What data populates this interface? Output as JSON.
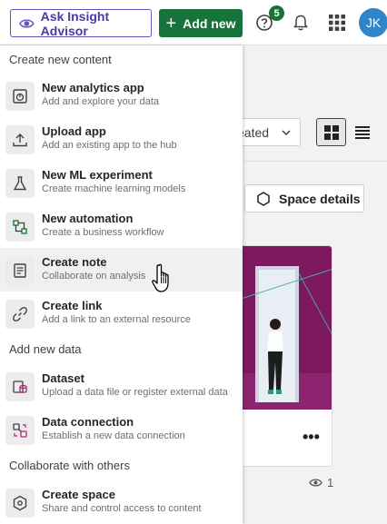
{
  "topbar": {
    "insight_label": "Ask Insight Advisor",
    "add_label": "Add new",
    "help_badge": "5",
    "avatar_initials": "JK",
    "colors": {
      "add_button": "#16733a",
      "insight_border": "#6b4fbb",
      "avatar": "#2f85c8"
    }
  },
  "background": {
    "sort_value": "eated",
    "space_details_label": "Space details",
    "card_views": "1"
  },
  "menu": {
    "section_create": "Create new content",
    "section_data": "Add new data",
    "section_collab": "Collaborate with others",
    "items": [
      {
        "title": "New analytics app",
        "subtitle": "Add and explore your data",
        "icon": "analytics-app-icon"
      },
      {
        "title": "Upload app",
        "subtitle": "Add an existing app to the hub",
        "icon": "upload-icon"
      },
      {
        "title": "New ML experiment",
        "subtitle": "Create machine learning models",
        "icon": "flask-icon"
      },
      {
        "title": "New automation",
        "subtitle": "Create a business workflow",
        "icon": "automation-icon"
      },
      {
        "title": "Create note",
        "subtitle": "Collaborate on analysis",
        "icon": "note-icon"
      },
      {
        "title": "Create link",
        "subtitle": "Add a link to an external resource",
        "icon": "link-icon"
      },
      {
        "title": "Dataset",
        "subtitle": "Upload a data file or register external data",
        "icon": "dataset-icon"
      },
      {
        "title": "Data connection",
        "subtitle": "Establish a new data connection",
        "icon": "connection-icon"
      },
      {
        "title": "Create space",
        "subtitle": "Share and control access to content",
        "icon": "space-icon"
      }
    ]
  }
}
